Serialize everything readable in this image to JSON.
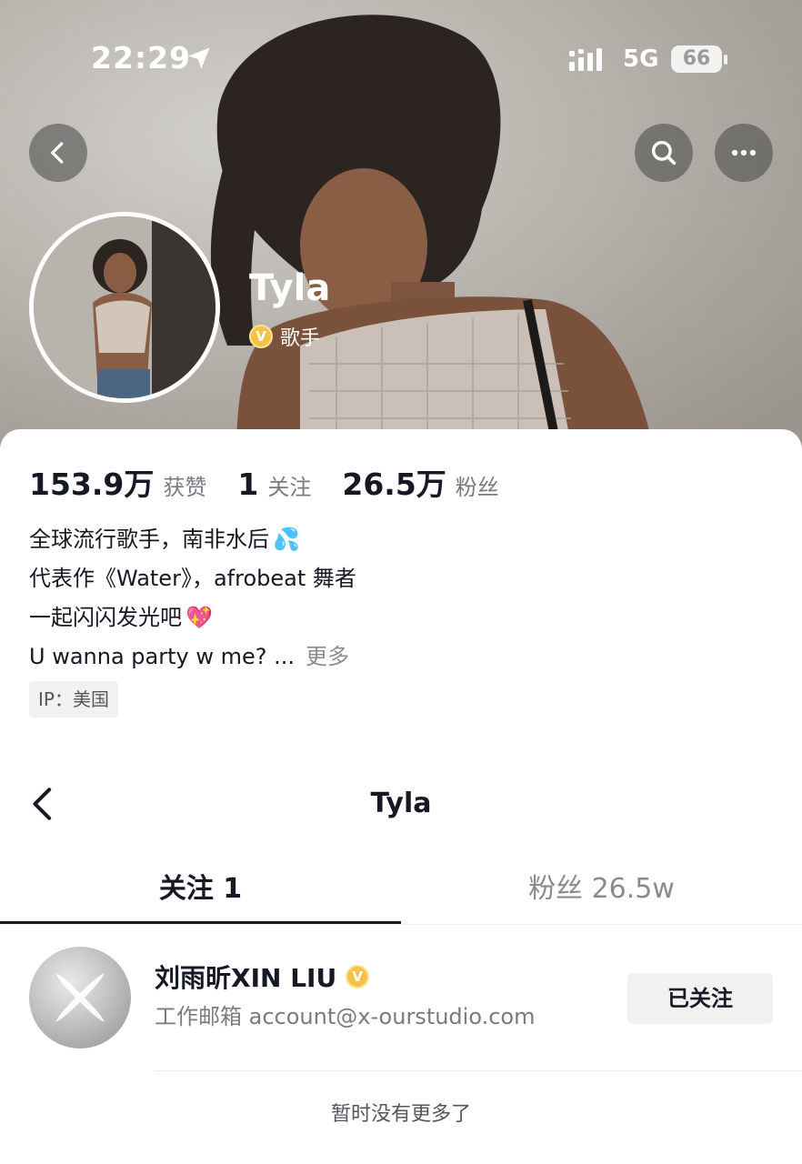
{
  "status_bar": {
    "time": "22:29",
    "network": "5G",
    "battery": "66"
  },
  "header": {
    "back_icon": "chevron-left-icon",
    "search_icon": "search-icon",
    "more_icon": "more-dots-icon"
  },
  "profile": {
    "name": "Tyla",
    "verified_badge": "V",
    "verified_label": "歌手",
    "badge_color": "#f6c244"
  },
  "stats": [
    {
      "value": "153.9万",
      "label": "获赞"
    },
    {
      "value": "1",
      "label": "关注"
    },
    {
      "value": "26.5万",
      "label": "粉丝"
    }
  ],
  "bio": {
    "line1": "全球流行歌手，南非水后",
    "line1_emoji": "💦",
    "line2": "代表作《Water》，afrobeat 舞者",
    "line3": "一起闪闪发光吧",
    "line3_emoji": "💖",
    "line4": "U wanna party w me? ...",
    "more": "更多"
  },
  "ip_tag": "IP：美国",
  "follow_list": {
    "title": "Tyla",
    "tabs": [
      {
        "label": "关注 1",
        "active": true
      },
      {
        "label": "粉丝 26.5w",
        "active": false
      }
    ],
    "items": [
      {
        "name": "刘雨昕XIN LIU",
        "badge": "V",
        "description": "工作邮箱 account@x-ourstudio.com",
        "button": "已关注"
      }
    ],
    "end_text": "暂时没有更多了"
  }
}
